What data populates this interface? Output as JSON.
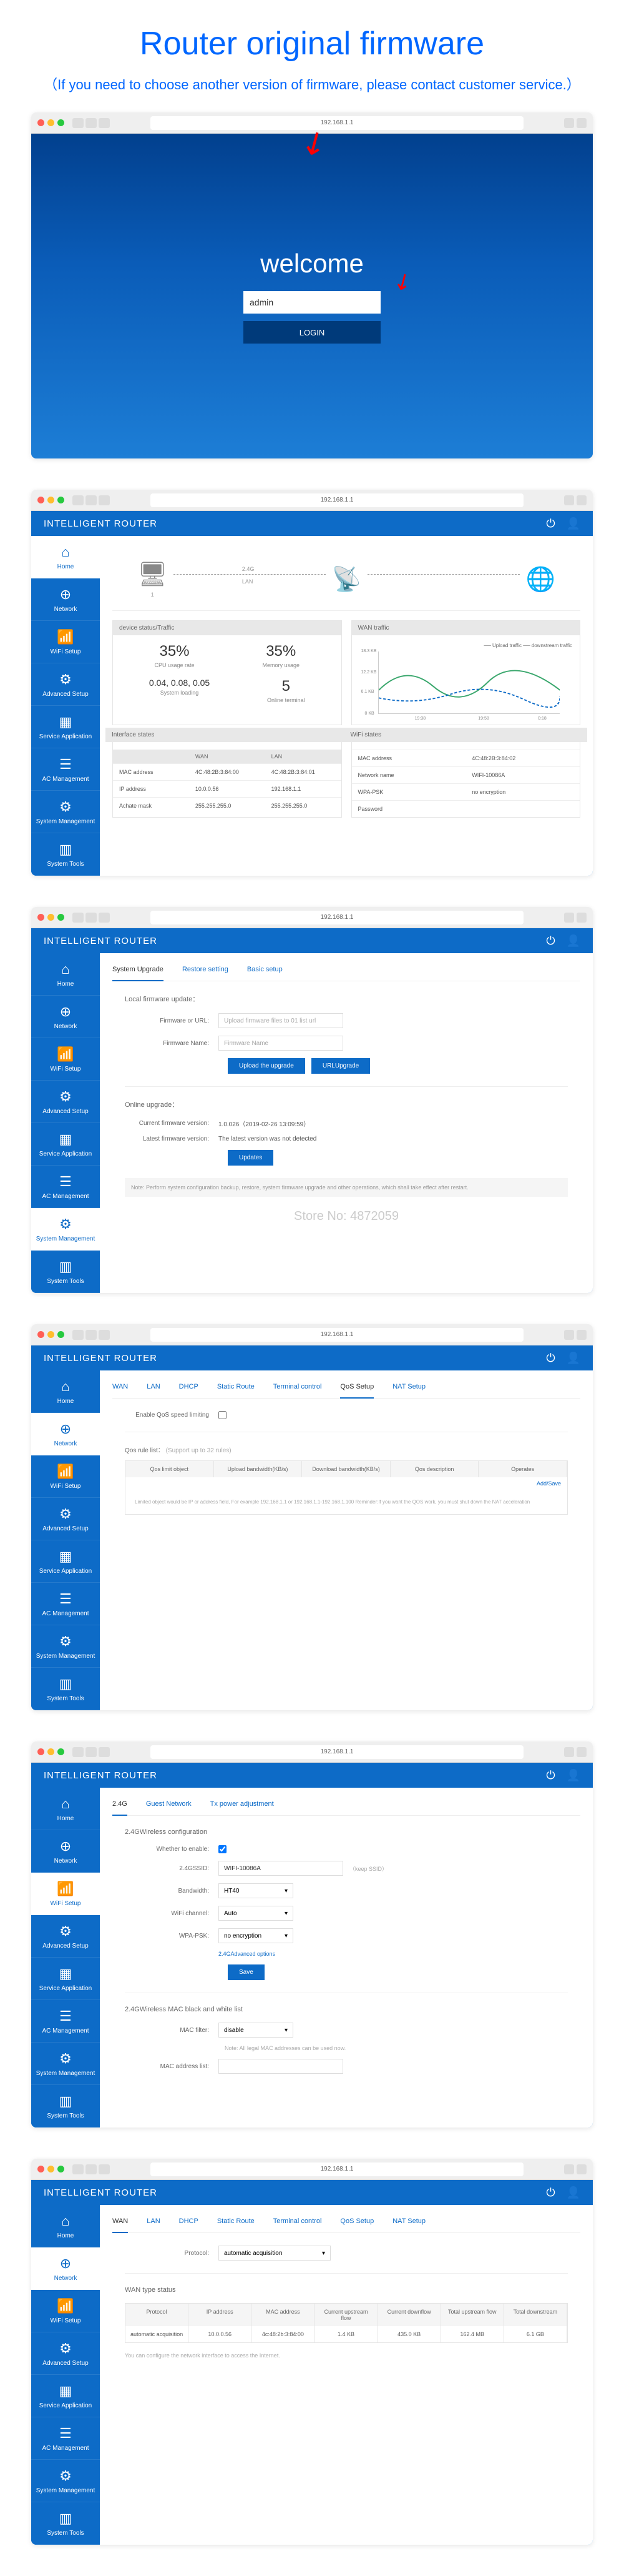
{
  "header": {
    "title": "Router original firmware",
    "subtitle": "（If you need to choose another version of firmware, please contact customer service.）"
  },
  "browser": {
    "url": "192.168.1.1"
  },
  "sidebar": {
    "items": [
      {
        "icon": "⌂",
        "label": "Home"
      },
      {
        "icon": "⊕",
        "label": "Network"
      },
      {
        "icon": "📶",
        "label": "WiFi Setup"
      },
      {
        "icon": "⚙",
        "label": "Advanced Setup"
      },
      {
        "icon": "▦",
        "label": "Service Application"
      },
      {
        "icon": "☰",
        "label": "AC Management"
      },
      {
        "icon": "⚙",
        "label": "System Management"
      },
      {
        "icon": "▥",
        "label": "System Tools"
      }
    ]
  },
  "login": {
    "welcome": "welcome",
    "value": "admin",
    "button": "LOGIN"
  },
  "router": {
    "title": "INTELLIGENT ROUTER"
  },
  "home": {
    "topo": {
      "lan": "LAN",
      "wan": "2.4G",
      "devices": "1"
    },
    "device_status": {
      "title": "device status/Traffic",
      "cpu": {
        "val": "35%",
        "label": "CPU usage rate"
      },
      "mem": {
        "val": "35%",
        "label": "Memory usage"
      },
      "load": {
        "val": "0.04, 0.08, 0.05",
        "label": "System loading"
      },
      "online": {
        "val": "5",
        "label": "Online terminal"
      }
    },
    "wan_traffic": {
      "title": "WAN traffic",
      "legend": "── Upload traffic ── downstream traffic",
      "ymax": "18.3 KB",
      "ymid": "12.2 KB",
      "ylow": "6.1 KB",
      "ymin": "0 KB",
      "x1": "19:38",
      "x2": "19:58",
      "x3": "0:18"
    },
    "interface": {
      "title": "Interface states",
      "headers": [
        "",
        "WAN",
        "LAN"
      ],
      "rows": [
        [
          "MAC address",
          "4C:48:2B:3:84:00",
          "4C:48:2B:3:84:01"
        ],
        [
          "IP address",
          "10.0.0.56",
          "192.168.1.1"
        ],
        [
          "Achate mask",
          "255.255.255.0",
          "255.255.255.0"
        ]
      ]
    },
    "wifi": {
      "title": "WiFi states",
      "rows": [
        [
          "MAC address",
          "4C:48:2B:3:84:02"
        ],
        [
          "Network name",
          "WIFI-10086A"
        ],
        [
          "WPA-PSK",
          "no encryption"
        ],
        [
          "Password",
          ""
        ]
      ]
    }
  },
  "upgrade": {
    "tabs": [
      "System Upgrade",
      "Restore setting",
      "Basic setup"
    ],
    "local_label": "Local firmware update：",
    "url_label": "Firmware or URL:",
    "url_placeholder": "Upload firmware files to 01 list url",
    "name_label": "Firmware Name:",
    "name_placeholder": "Firmware Name",
    "btn_upload": "Upload the upgrade",
    "btn_url": "URLUpgrade",
    "online_label": "Online upgrade：",
    "current_label": "Current firmware version:",
    "current_val": "1.0.026（2019-02-26 13:09:59）",
    "latest_label": "Latest firmware version:",
    "latest_val": "The latest version was not detected",
    "btn_updates": "Updates",
    "note": "Note: Perform system configuration backup, restore, system firmware upgrade and other operations, which shall take effect after restart.",
    "watermark": "Store No: 4872059"
  },
  "qos": {
    "tabs": [
      "WAN",
      "LAN",
      "DHCP",
      "Static Route",
      "Terminal control",
      "QoS Setup",
      "NAT Setup"
    ],
    "enable": "Enable QoS speed limiting",
    "rule_label": "Qos rule list：",
    "rule_hint": "(Support up to 32 rules)",
    "headers": [
      "Qos limit object",
      "Upload bandwidth(KB/s)",
      "Download bandwidth(KB/s)",
      "Qos description",
      "Operates"
    ],
    "add": "Add/Save",
    "body_hint": "Limited object would be IP or address field, For example 192.168.1.1 or 192.168.1.1-192.168.1.100 Reminder:If you want the QOS work, you must shut down the NAT acceleration"
  },
  "wifi": {
    "tabs": [
      "2.4G",
      "Guest Network",
      "Tx power adjustment"
    ],
    "section1": "2.4GWireless configuration",
    "enable_label": "Whether to enable:",
    "ssid_label": "2.4GSSID:",
    "ssid_val": "WIFI-10086A",
    "ssid_hint": "（keep SSID）",
    "bw_label": "Bandwidth:",
    "bw_val": "HT40",
    "ch_label": "WiFi channel:",
    "ch_val": "Auto",
    "wpa_label": "WPA-PSK:",
    "wpa_val": "no encryption",
    "adv_link": "2.4GAdvanced options",
    "btn_save": "Save",
    "section2": "2.4GWireless MAC black and white list",
    "mac_filter_label": "MAC filter:",
    "mac_filter_val": "disable",
    "mac_note": "Note: All legal MAC addresses can be used now.",
    "mac_list_label": "MAC address list:"
  },
  "wan": {
    "tabs": [
      "WAN",
      "LAN",
      "DHCP",
      "Static Route",
      "Terminal control",
      "QoS Setup",
      "NAT Setup"
    ],
    "protocol_label": "Protocol:",
    "protocol_val": "automatic acquisition",
    "section": "WAN type status",
    "headers": [
      "Protocol",
      "IP address",
      "MAC address",
      "Current upstream flow",
      "Current downflow",
      "Total upstream flow",
      "Total downstream"
    ],
    "row": [
      "automatic acquisition",
      "10.0.0.56",
      "4c:48:2b:3:84:00",
      "1.4 KB",
      "435.0 KB",
      "162.4 MB",
      "6.1 GB"
    ],
    "hint": "You can configure the network interface to access the Internet."
  }
}
